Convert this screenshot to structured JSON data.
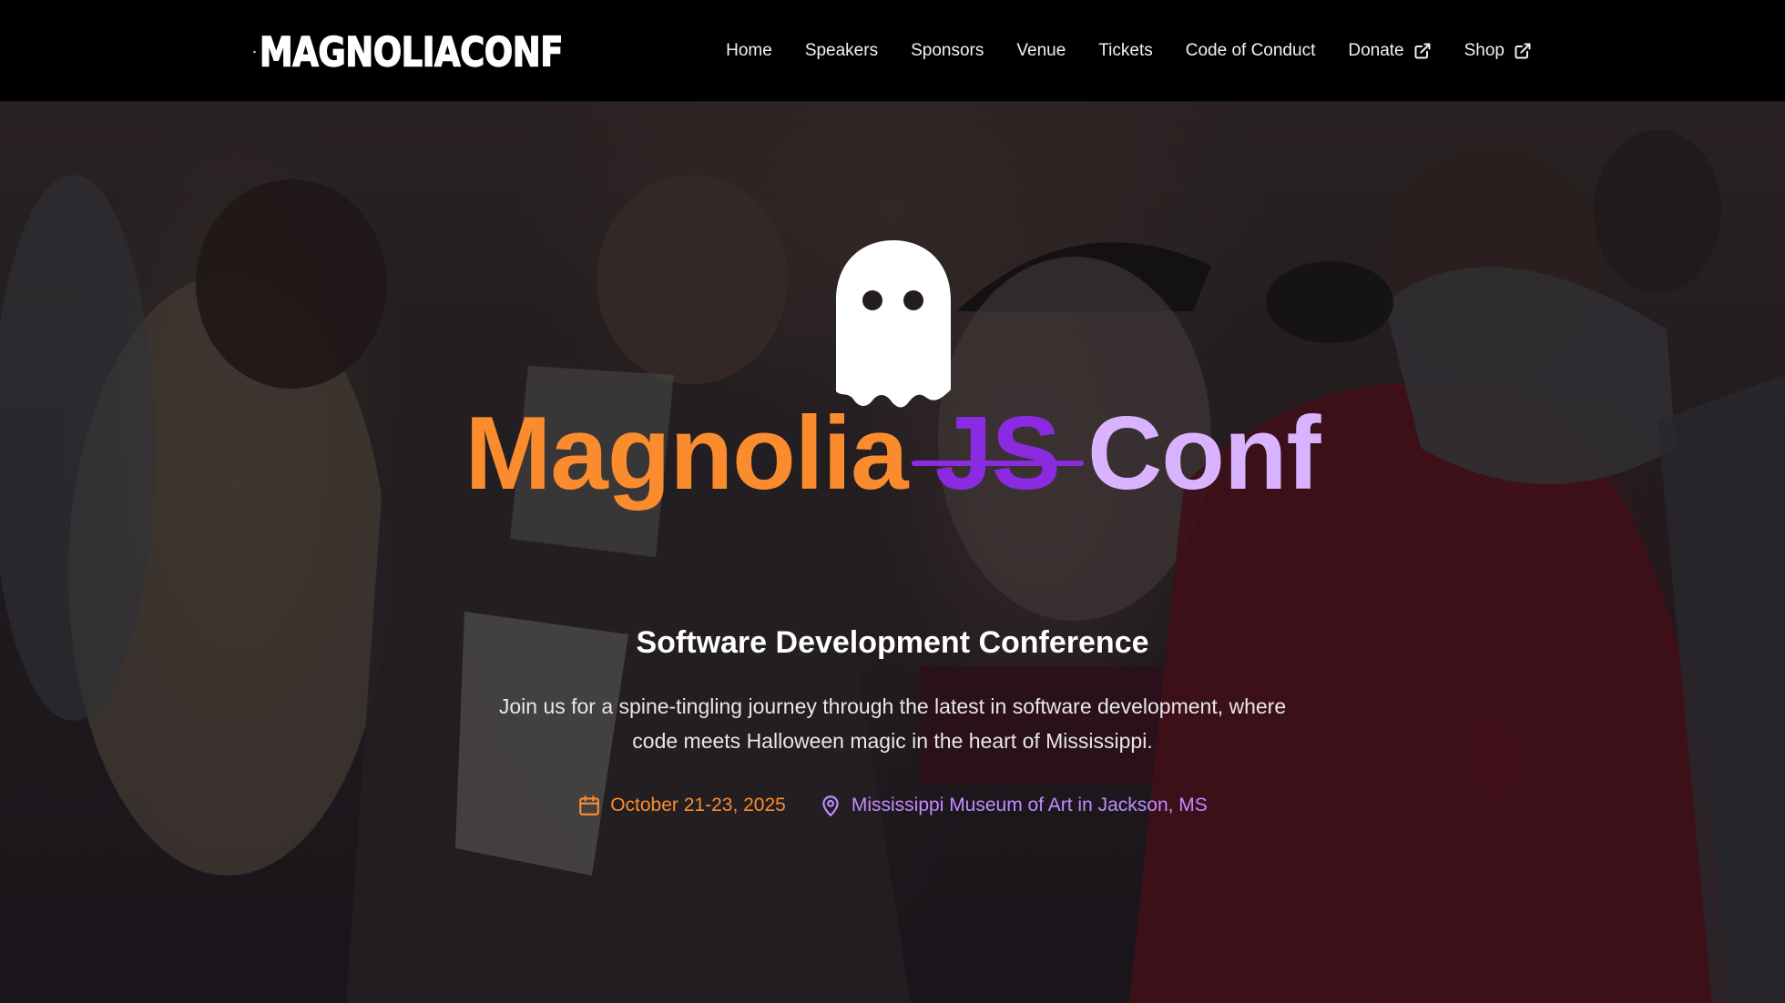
{
  "header": {
    "logo_text": "MAGNOLIACONF",
    "logo_icon": "jack-o-lantern-icon",
    "nav": [
      {
        "label": "Home"
      },
      {
        "label": "Speakers"
      },
      {
        "label": "Sponsors"
      },
      {
        "label": "Venue"
      },
      {
        "label": "Tickets"
      },
      {
        "label": "Code of Conduct"
      },
      {
        "label": "Donate",
        "icon": "external-link-icon"
      },
      {
        "label": "Shop",
        "icon": "external-link-icon"
      }
    ]
  },
  "hero": {
    "ghost_icon": "ghost-icon",
    "title_part1": "Magnolia",
    "title_strike": "JS",
    "title_part2": "Conf",
    "subtitle": "Software Development Conference",
    "description": "Join us for a spine-tingling journey through the latest in software development, where code meets Halloween magic in the heart of Mississippi.",
    "date": "October 21-23, 2025",
    "date_icon": "calendar-icon",
    "location": "Mississippi Museum of Art in Jackson, MS",
    "location_icon": "map-pin-icon"
  },
  "colors": {
    "header_bg": "#000000",
    "accent_orange": "#fb8c2e",
    "accent_purple": "#8a2be2",
    "accent_lavender": "#d9b3ff",
    "location_purple": "#c28bff"
  }
}
